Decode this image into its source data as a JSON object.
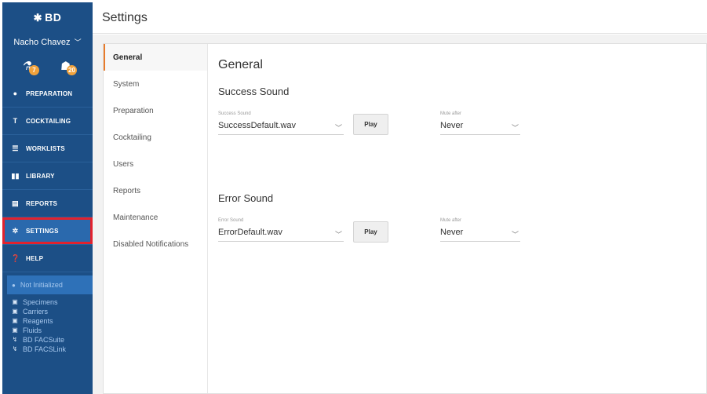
{
  "sidebar": {
    "brand": "BD",
    "user": "Nacho Chavez",
    "badges": [
      {
        "icon": "flask-icon",
        "count": "7"
      },
      {
        "icon": "tube-rack-icon",
        "count": "20"
      }
    ],
    "nav": [
      {
        "label": "PREPARATION",
        "icon": "drop-icon"
      },
      {
        "label": "COCKTAILING",
        "icon": "cocktail-icon"
      },
      {
        "label": "WORKLISTS",
        "icon": "list-icon"
      },
      {
        "label": "LIBRARY",
        "icon": "book-icon"
      },
      {
        "label": "REPORTS",
        "icon": "report-icon"
      },
      {
        "label": "SETTINGS",
        "icon": "gear-icon"
      },
      {
        "label": "HELP",
        "icon": "help-icon"
      }
    ],
    "active_nav": "SETTINGS",
    "status": "Not Initialized",
    "resources": [
      "Specimens",
      "Carriers",
      "Reagents",
      "Fluids",
      "BD FACSuite",
      "BD FACSLink"
    ]
  },
  "header": {
    "title": "Settings"
  },
  "settings": {
    "subnav": [
      "General",
      "System",
      "Preparation",
      "Cocktailing",
      "Users",
      "Reports",
      "Maintenance",
      "Disabled Notifications"
    ],
    "active_subnav": "General",
    "heading": "General",
    "success": {
      "heading": "Success Sound",
      "sound_label": "Success Sound",
      "sound_value": "SuccessDefault.wav",
      "play_label": "Play",
      "mute_label": "Mute after",
      "mute_value": "Never"
    },
    "error": {
      "heading": "Error Sound",
      "sound_label": "Error Sound",
      "sound_value": "ErrorDefault.wav",
      "play_label": "Play",
      "mute_label": "Mute after",
      "mute_value": "Never"
    }
  },
  "colors": {
    "sidebar": "#1c4f86",
    "highlight": "#e2222d",
    "active_tab_accent": "#e87b2b",
    "badge": "#f0a23c"
  }
}
